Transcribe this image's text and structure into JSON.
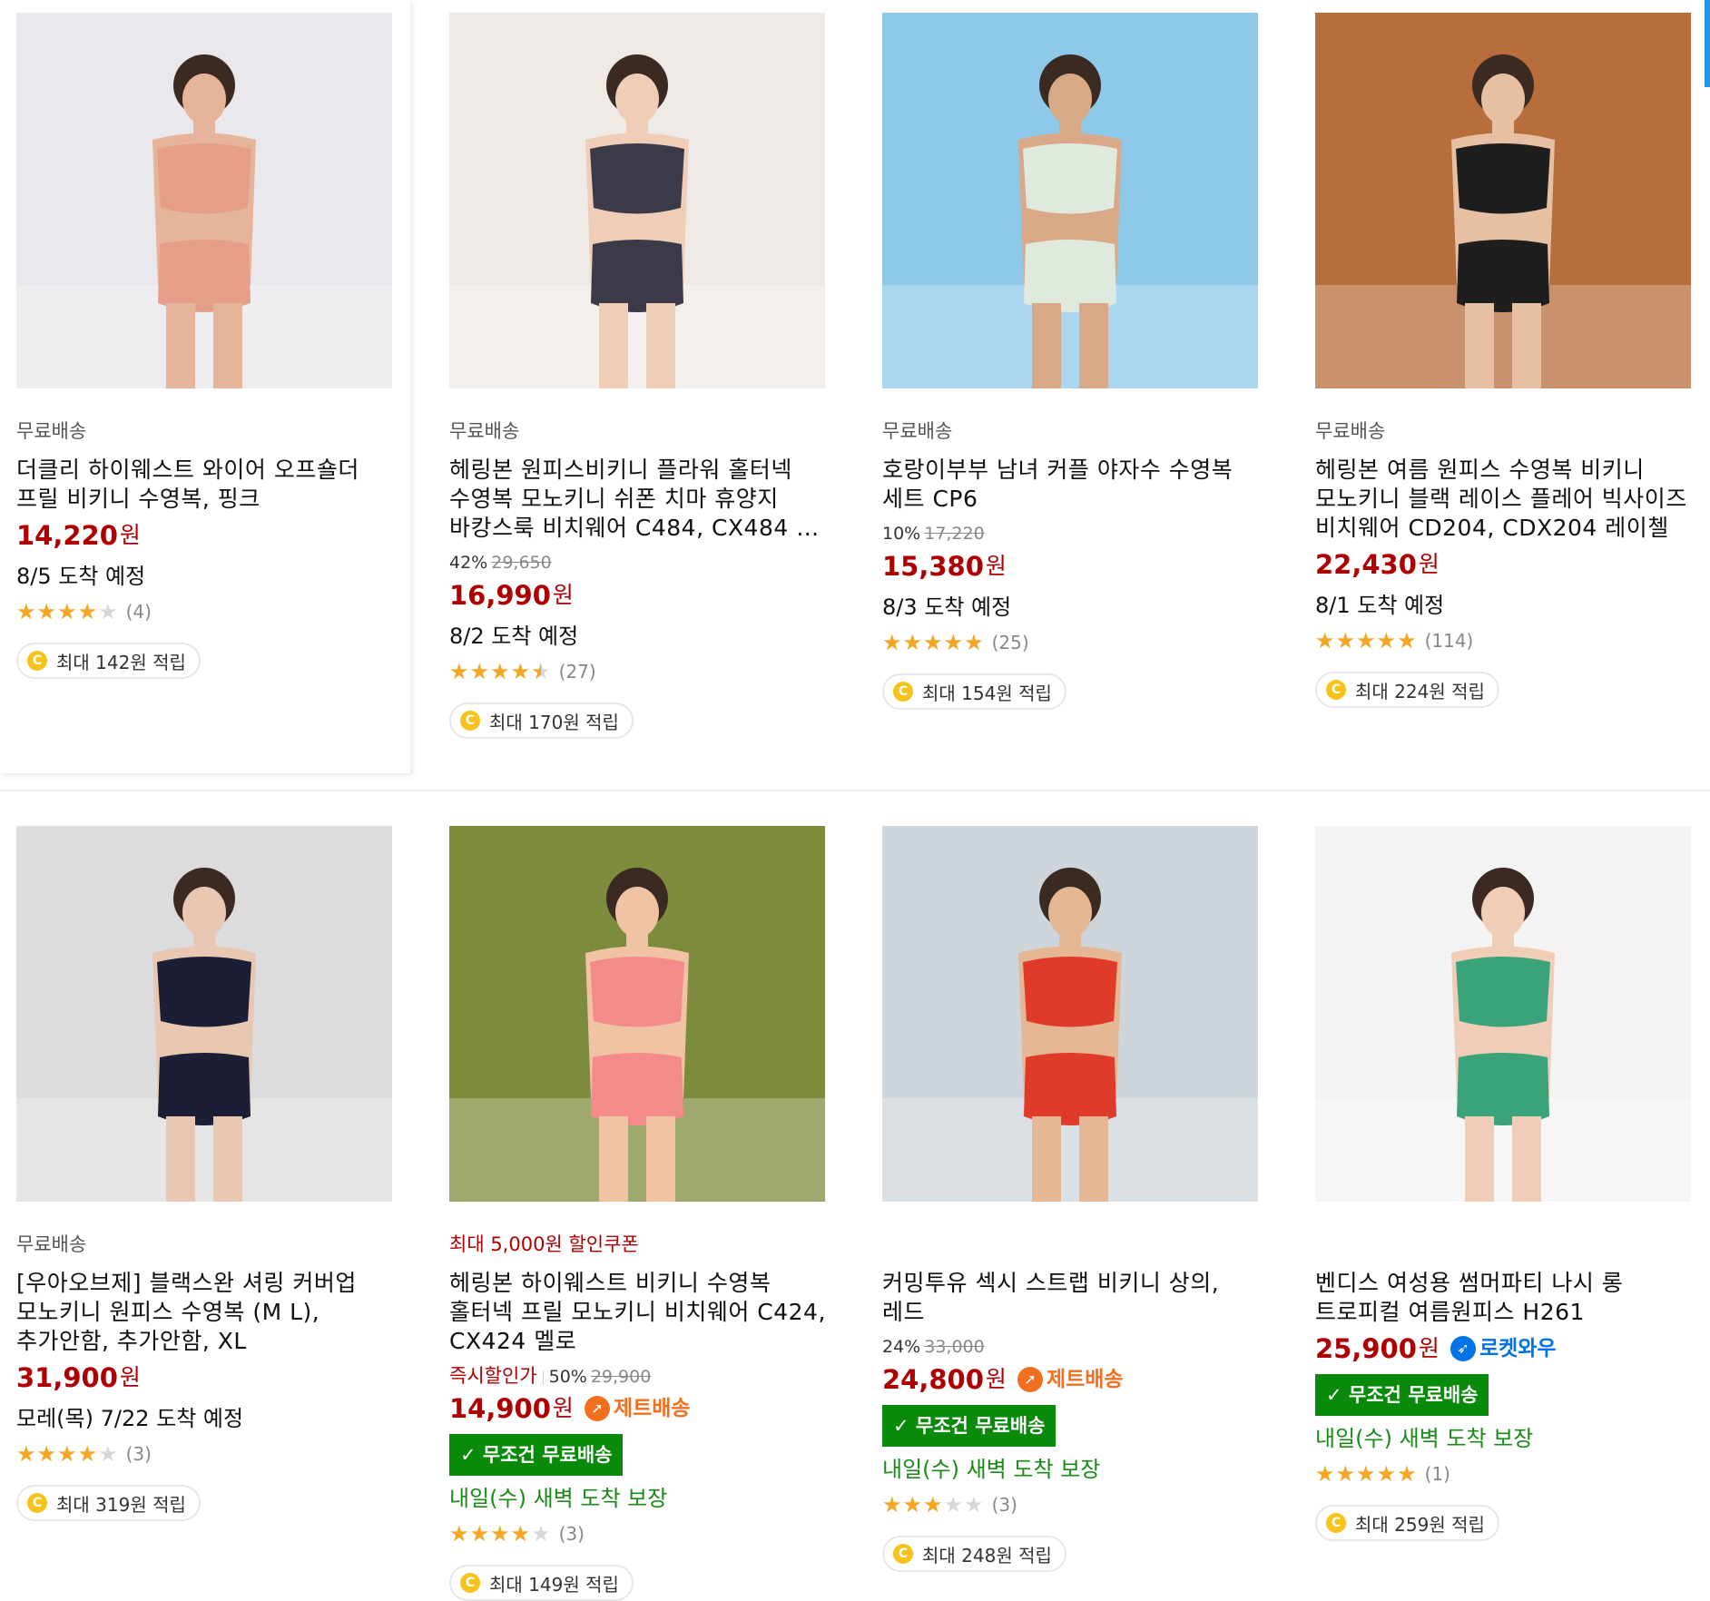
{
  "products": [
    {
      "tag": "무료배송",
      "tag_type": "plain",
      "title": "더클리 하이웨스트 와이어 오프숄더 프릴 비키니 수영복, 핑크",
      "discount": "",
      "original_price": "",
      "instant": "",
      "price": "14,220",
      "won": "원",
      "badge": "",
      "free_shipping": "",
      "delivery": "8/5 도착 예정",
      "delivery_type": "normal",
      "rating": 4,
      "reviews": "(4)",
      "reward": "최대 142원 적립",
      "image": "pink ruffle bikini"
    },
    {
      "tag": "무료배송",
      "tag_type": "plain",
      "title": "헤링본 원피스비키니 플라워 홀터넥 수영복 모노키니 쉬폰 치마 휴양지 바캉스룩 비치웨어 C484, CX484 …",
      "discount": "42%",
      "original_price": "29,650",
      "instant": "",
      "price": "16,990",
      "won": "원",
      "badge": "",
      "free_shipping": "",
      "delivery": "8/2 도착 예정",
      "delivery_type": "normal",
      "rating": 4.5,
      "reviews": "(27)",
      "reward": "최대 170원 적립",
      "image": "floral halter monokini"
    },
    {
      "tag": "무료배송",
      "tag_type": "plain",
      "title": "호랑이부부 남녀 커플 야자수 수영복 세트 CP6",
      "discount": "10%",
      "original_price": "17,220",
      "instant": "",
      "price": "15,380",
      "won": "원",
      "badge": "",
      "free_shipping": "",
      "delivery": "8/3 도착 예정",
      "delivery_type": "normal",
      "rating": 5,
      "reviews": "(25)",
      "reward": "최대 154원 적립",
      "image": "couple palm leaf swimwear"
    },
    {
      "tag": "무료배송",
      "tag_type": "plain",
      "title": "헤링본 여름 원피스 수영복 비키니 모노키니 블랙 레이스 플레어 빅사이즈 비치웨어 CD204, CDX204 레이첼",
      "discount": "",
      "original_price": "",
      "instant": "",
      "price": "22,430",
      "won": "원",
      "badge": "",
      "free_shipping": "",
      "delivery": "8/1 도착 예정",
      "delivery_type": "normal",
      "rating": 5,
      "reviews": "(114)",
      "reward": "최대 224원 적립",
      "image": "black lace swim dress"
    },
    {
      "tag": "무료배송",
      "tag_type": "plain",
      "title": "[우아오브제] 블랙스완 셔링 커버업 모노키니 원피스 수영복 (M L), 추가안함, 추가안함, XL",
      "discount": "",
      "original_price": "",
      "instant": "",
      "price": "31,900",
      "won": "원",
      "badge": "",
      "free_shipping": "",
      "delivery": "모레(목) 7/22 도착 예정",
      "delivery_type": "normal",
      "rating": 4,
      "reviews": "(3)",
      "reward": "최대 319원 적립",
      "image": "navy shirring monokini"
    },
    {
      "tag": "최대 5,000원 할인쿠폰",
      "tag_type": "coupon",
      "title": "헤링본 하이웨스트 비키니 수영복 홀터넥 프릴 모노키니 비치웨어 C424, CX424 멜로",
      "discount": "50%",
      "original_price": "29,900",
      "instant": "즉시할인가",
      "price": "14,900",
      "won": "원",
      "badge": "제트배송",
      "badge_type": "jet",
      "free_shipping": "무조건 무료배송",
      "delivery": "내일(수) 새벽 도착 보장",
      "delivery_type": "green",
      "rating": 4,
      "reviews": "(3)",
      "reward": "최대 149원 적립",
      "image": "coral highwaist bikini"
    },
    {
      "tag": "",
      "tag_type": "plain",
      "title": "커밍투유 섹시 스트랩 비키니 상의, 레드",
      "discount": "24%",
      "original_price": "33,000",
      "instant": "",
      "price": "24,800",
      "won": "원",
      "badge": "제트배송",
      "badge_type": "jet",
      "free_shipping": "무조건 무료배송",
      "delivery": "내일(수) 새벽 도착 보장",
      "delivery_type": "green",
      "rating": 3,
      "reviews": "(3)",
      "reward": "최대 248원 적립",
      "image": "red strap bikini top"
    },
    {
      "tag": "",
      "tag_type": "plain",
      "title": "벤디스 여성용 썸머파티 나시 롱 트로피컬 여름원피스 H261",
      "discount": "",
      "original_price": "",
      "instant": "",
      "price": "25,900",
      "won": "원",
      "badge": "로켓와우",
      "badge_type": "rocket",
      "free_shipping": "무조건 무료배송",
      "delivery": "내일(수) 새벽 도착 보장",
      "delivery_type": "green",
      "rating": 5,
      "reviews": "(1)",
      "reward": "최대 259원 적립",
      "image": "tropical long summer dress"
    }
  ],
  "colors": {
    "price": "#ae0000",
    "star": "#f5a623",
    "free_ship_bg": "#0a8a0a",
    "rocket": "#0073e9",
    "jet": "#f36f20",
    "green_text": "#178b15"
  },
  "icons": {
    "coin": "coin-icon",
    "check": "check-icon",
    "rocket": "rocket-icon",
    "jet": "jet-icon"
  }
}
